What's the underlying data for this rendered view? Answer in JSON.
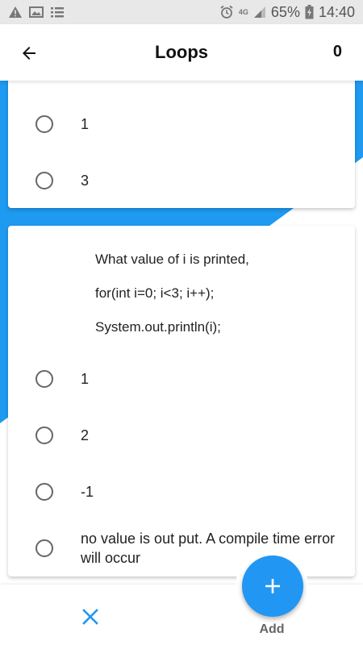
{
  "status_bar": {
    "network": "4G",
    "battery_percent": "65%",
    "time": "14:40"
  },
  "app_bar": {
    "title": "Loops",
    "score": "0"
  },
  "previous_card": {
    "options": [
      {
        "label": "1"
      },
      {
        "label": "3"
      }
    ]
  },
  "question_card": {
    "question_lines": [
      "What value of i is printed,",
      "for(int i=0; i<3; i++);",
      "System.out.println(i);"
    ],
    "options": [
      {
        "label": "1"
      },
      {
        "label": "2"
      },
      {
        "label": "-1"
      },
      {
        "label": "no value is out put. A compile time error will occur"
      }
    ]
  },
  "bottom_bar": {
    "add_label": "Add"
  },
  "colors": {
    "accent": "#2196f3",
    "background_shape": "#1e9af1"
  }
}
